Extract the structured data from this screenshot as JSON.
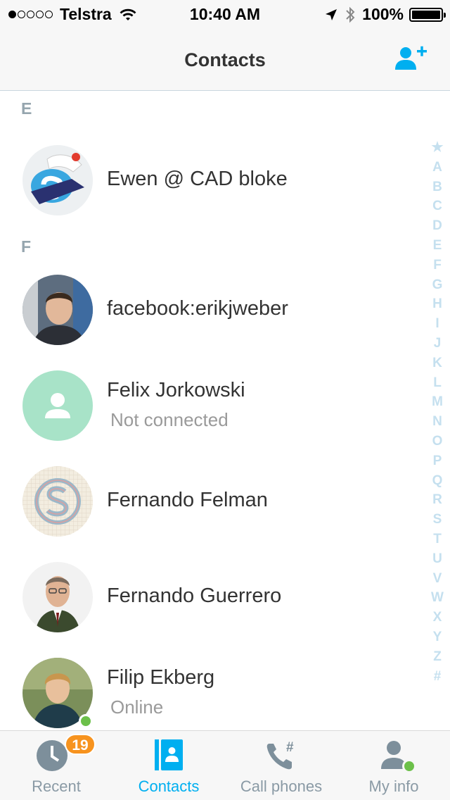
{
  "status_bar": {
    "carrier": "Telstra",
    "signal_dots": 5,
    "signal_filled": 1,
    "time": "10:40 AM",
    "battery": "100%"
  },
  "nav": {
    "title": "Contacts",
    "add_icon": "add-contact-icon"
  },
  "sections": [
    {
      "letter": "E"
    },
    {
      "letter": "F"
    }
  ],
  "contacts": [
    {
      "name": "Ewen @ CAD bloke",
      "status": "",
      "avatar": "skype-sailor-avatar"
    },
    {
      "name": "facebook:erikjweber",
      "status": "",
      "avatar": "photo-avatar"
    },
    {
      "name": "Felix Jorkowski",
      "status": "Not connected",
      "avatar": "placeholder-avatar"
    },
    {
      "name": "Fernando Felman",
      "status": "",
      "avatar": "skype-logo-avatar"
    },
    {
      "name": "Fernando Guerrero",
      "status": "",
      "avatar": "photo-avatar"
    },
    {
      "name": "Filip Ekberg",
      "status": "Online",
      "avatar": "photo-avatar",
      "online": true
    }
  ],
  "index_letters": [
    "★",
    "A",
    "B",
    "C",
    "D",
    "E",
    "F",
    "G",
    "H",
    "I",
    "J",
    "K",
    "L",
    "M",
    "N",
    "O",
    "P",
    "Q",
    "R",
    "S",
    "T",
    "U",
    "V",
    "W",
    "X",
    "Y",
    "Z",
    "#"
  ],
  "tabs": [
    {
      "label": "Recent",
      "icon": "clock-icon",
      "badge": "19"
    },
    {
      "label": "Contacts",
      "icon": "contacts-book-icon",
      "active": true
    },
    {
      "label": "Call phones",
      "icon": "phone-hash-icon"
    },
    {
      "label": "My info",
      "icon": "person-icon",
      "online": true
    }
  ],
  "colors": {
    "accent": "#00aff0",
    "badge": "#f7931e",
    "online": "#6cc04a",
    "index": "#c5e0ef",
    "section_header": "#95a5ae"
  }
}
